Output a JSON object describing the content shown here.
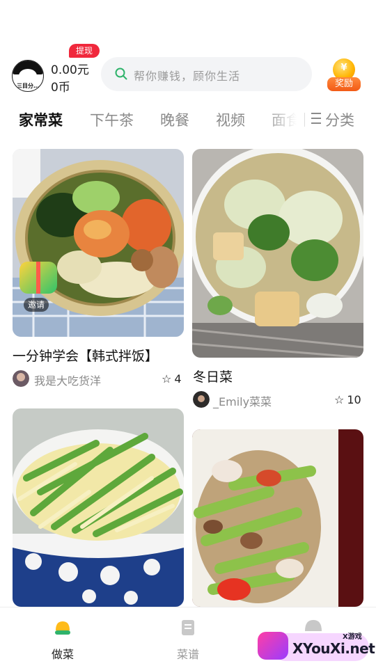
{
  "header": {
    "avatar_tag": "三目分…",
    "balance_money": "0.00元",
    "balance_coins": "0币",
    "withdraw_badge": "提现",
    "search_placeholder": "帮你赚钱，顾你生活",
    "reward_coin": "¥",
    "reward_label": "奖励"
  },
  "tabs": [
    {
      "label": "家常菜",
      "active": true
    },
    {
      "label": "下午茶",
      "active": false
    },
    {
      "label": "晚餐",
      "active": false
    },
    {
      "label": "视频",
      "active": false
    },
    {
      "label": "面食",
      "active": false
    }
  ],
  "categories_label": "分类",
  "cards": [
    {
      "title": "一分钟学会【韩式拌饭】",
      "author": "我是大吃货洋",
      "favorites": "4"
    },
    {
      "title": "冬日菜",
      "author": "_Emily菜菜",
      "favorites": "10"
    },
    {
      "title": "",
      "author": "",
      "favorites": ""
    },
    {
      "title": "",
      "author": "",
      "favorites": ""
    }
  ],
  "invite_label": "邀请",
  "bottom_nav": [
    {
      "label": "做菜",
      "icon": "cooking-pot-icon",
      "active": true
    },
    {
      "label": "菜谱",
      "icon": "recipe-book-icon",
      "active": false
    },
    {
      "label": "",
      "icon": "profile-icon",
      "active": false
    }
  ],
  "watermark": {
    "brand": "XYouXi.net",
    "small": "X游戏"
  },
  "colors": {
    "accent_green": "#2fb36b",
    "badge_red": "#f0283c",
    "reward_orange": "#f25a16",
    "nav_active_yellow": "#ffbb1a"
  }
}
